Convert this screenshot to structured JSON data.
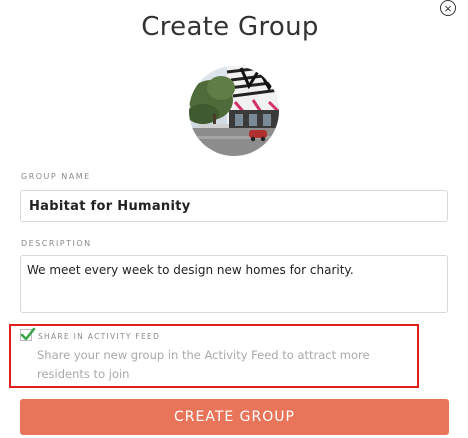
{
  "dialog": {
    "title": "Create Group",
    "close_icon": "close-icon",
    "close_glyph": "×"
  },
  "group_photo": {
    "icon": "group-photo"
  },
  "group_name": {
    "label": "GROUP NAME",
    "value": "Habitat for Humanity"
  },
  "description": {
    "label": "DESCRIPTION",
    "value": "We meet every week to design new homes for charity."
  },
  "share": {
    "checked": true,
    "label": "SHARE IN ACTIVITY FEED",
    "description": "Share your new group in the Activity Feed to attract more residents to join"
  },
  "submit": {
    "label": "CREATE GROUP"
  },
  "colors": {
    "accent": "#e8755a",
    "highlight_border": "#e0201d",
    "checkmark": "#3aa64a"
  }
}
